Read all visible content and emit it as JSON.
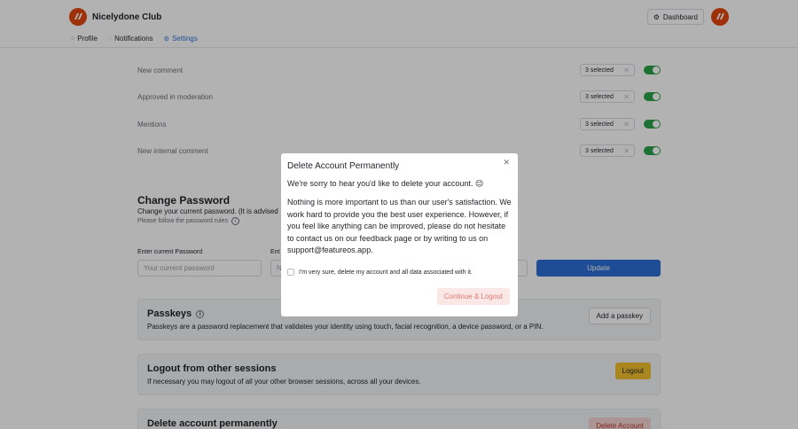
{
  "app": {
    "brand_name": "Nicelydone Club",
    "dashboard_label": "Dashboard",
    "brand_color": "#e2450f"
  },
  "tabs": [
    {
      "label": "Profile",
      "icon": "user-icon"
    },
    {
      "label": "Notifications",
      "icon": "bell-icon"
    },
    {
      "label": "Settings",
      "icon": "gear-icon",
      "active": true
    }
  ],
  "notifications": [
    {
      "label": "New comment",
      "selection": "3 selected",
      "enabled": true
    },
    {
      "label": "Approved in moderation",
      "selection": "3 selected",
      "enabled": true
    },
    {
      "label": "Mentions",
      "selection": "3 selected",
      "enabled": true
    },
    {
      "label": "New internal comment",
      "selection": "3 selected",
      "enabled": true
    }
  ],
  "change_password": {
    "title": "Change Password",
    "subtitle": "Change your current password. (It is advised",
    "hint": "Please follow the password rules",
    "current_label": "Enter current Password",
    "current_placeholder": "Your current password",
    "new_label": "Ent",
    "new_placeholder": "N",
    "update_label": "Update"
  },
  "passkeys": {
    "title": "Passkeys",
    "description": "Passkeys are a password replacement that validates your identity using touch, facial recognition, a device password, or a PIN.",
    "button": "Add a passkey"
  },
  "logout_sessions": {
    "title": "Logout from other sessions",
    "description": "If necessary you may logout of all your other browser sessions, across all your devices.",
    "button": "Logout"
  },
  "delete_account": {
    "title": "Delete account permanently",
    "button": "Delete Account"
  },
  "modal": {
    "title": "Delete Account Permanently",
    "sorry": "We're sorry to hear you'd like to delete your account. 😔",
    "body": "Nothing is more important to us than our user's satisfaction. We work hard to provide you the best user experience. However, if you feel like anything can be improved, please do not hesitate to contact us on our feedback page or by writing to us on support@featureos.app.",
    "confirm_label": "I'm very sure, delete my account and all data associated with it.",
    "confirm_checked": false,
    "continue_label": "Continue & Logout"
  }
}
